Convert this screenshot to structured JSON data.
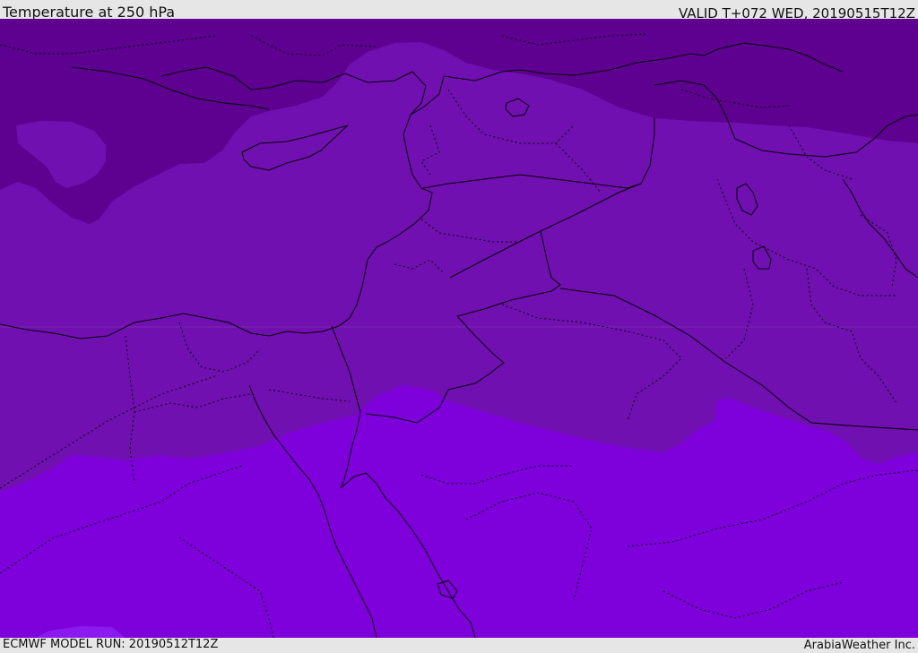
{
  "header": {
    "title": "Temperature at 250 hPa",
    "valid": "VALID T+072 WED, 20190515T12Z"
  },
  "footer": {
    "model_run": "ECMWF MODEL RUN: 20190512T12Z",
    "credit": "ArabiaWeather Inc."
  },
  "colors": {
    "band_coldest": "#5e0090",
    "band_cold": "#7110b0",
    "band_warm": "#7e00da",
    "band_warmest": "#8a1af0",
    "border_line": "#000000"
  }
}
